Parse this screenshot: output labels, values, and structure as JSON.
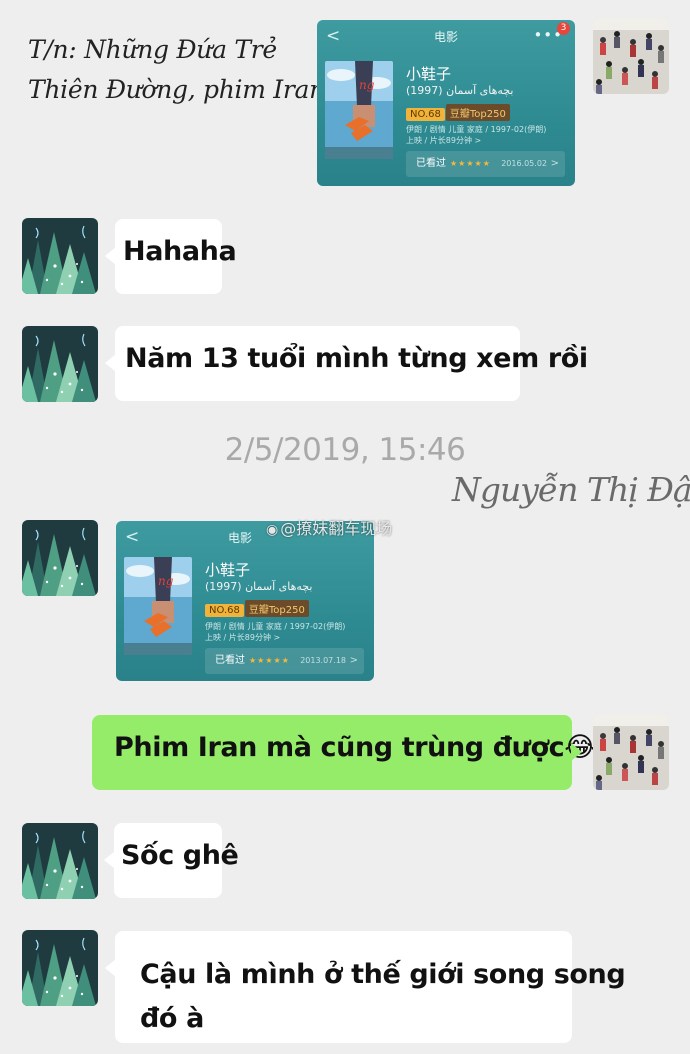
{
  "note": {
    "line1": "T/n: Những Đứa Trẻ",
    "line2": "Thiên Đường, phim Iran"
  },
  "card1": {
    "title": "电影",
    "back": "<",
    "more": "•••",
    "badge": "3",
    "movie_title": "小鞋子",
    "movie_subtitle": "بچه‌های آسمان (1997)",
    "rank": "NO.68",
    "list": "豆瓣Top250",
    "info": "伊朗 / 剧情 儿童 家庭 / 1997-02(伊朗)上映 / 片长89分钟 >",
    "status": "已看过",
    "stars": "★★★★★",
    "date": "2016.05.02",
    "chevron": ">"
  },
  "messages": {
    "m1": "Hahaha",
    "m2": "Năm 13 tuổi mình từng xem rồi",
    "m3": "Phim Iran mà cũng trùng được",
    "m3_emoji": "😂",
    "m4": "Sốc ghê",
    "m5_line1": "Cậu là mình ở thế giới song song",
    "m5_line2": "đó à"
  },
  "timestamp": "2/5/2019, 15:46",
  "signature": "Nguyễn Thị Đậu",
  "weibo": "@撩妹翻车现场",
  "card2": {
    "title": "电影",
    "back": "<",
    "movie_title": "小鞋子",
    "movie_subtitle": "بچه‌های آسمان (1997)",
    "rank": "NO.68",
    "list": "豆瓣Top250",
    "info": "伊朗 / 剧情 儿童 家庭 / 1997-02(伊朗)上映 / 片长89分钟 >",
    "status": "已看过",
    "stars": "★★★★★",
    "date": "2013.07.18",
    "chevron": ">"
  },
  "colors": {
    "background": "#eeeeee",
    "bubble_in": "#ffffff",
    "bubble_out": "#95ec69",
    "card": "#2e8b92"
  }
}
